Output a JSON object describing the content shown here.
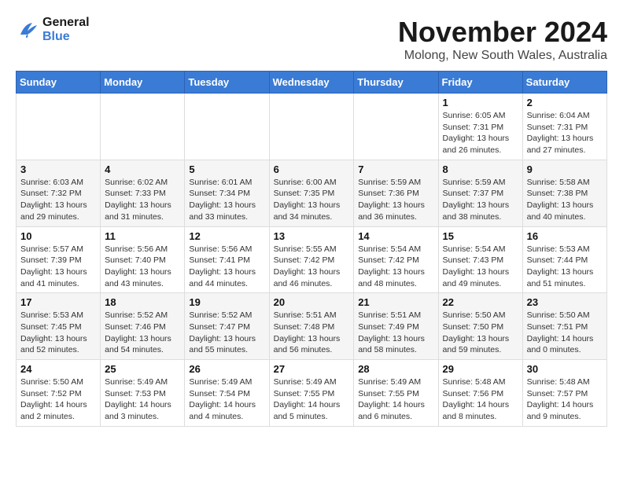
{
  "header": {
    "logo_line1": "General",
    "logo_line2": "Blue",
    "month": "November 2024",
    "location": "Molong, New South Wales, Australia"
  },
  "weekdays": [
    "Sunday",
    "Monday",
    "Tuesday",
    "Wednesday",
    "Thursday",
    "Friday",
    "Saturday"
  ],
  "weeks": [
    [
      {
        "day": "",
        "info": ""
      },
      {
        "day": "",
        "info": ""
      },
      {
        "day": "",
        "info": ""
      },
      {
        "day": "",
        "info": ""
      },
      {
        "day": "",
        "info": ""
      },
      {
        "day": "1",
        "info": "Sunrise: 6:05 AM\nSunset: 7:31 PM\nDaylight: 13 hours\nand 26 minutes."
      },
      {
        "day": "2",
        "info": "Sunrise: 6:04 AM\nSunset: 7:31 PM\nDaylight: 13 hours\nand 27 minutes."
      }
    ],
    [
      {
        "day": "3",
        "info": "Sunrise: 6:03 AM\nSunset: 7:32 PM\nDaylight: 13 hours\nand 29 minutes."
      },
      {
        "day": "4",
        "info": "Sunrise: 6:02 AM\nSunset: 7:33 PM\nDaylight: 13 hours\nand 31 minutes."
      },
      {
        "day": "5",
        "info": "Sunrise: 6:01 AM\nSunset: 7:34 PM\nDaylight: 13 hours\nand 33 minutes."
      },
      {
        "day": "6",
        "info": "Sunrise: 6:00 AM\nSunset: 7:35 PM\nDaylight: 13 hours\nand 34 minutes."
      },
      {
        "day": "7",
        "info": "Sunrise: 5:59 AM\nSunset: 7:36 PM\nDaylight: 13 hours\nand 36 minutes."
      },
      {
        "day": "8",
        "info": "Sunrise: 5:59 AM\nSunset: 7:37 PM\nDaylight: 13 hours\nand 38 minutes."
      },
      {
        "day": "9",
        "info": "Sunrise: 5:58 AM\nSunset: 7:38 PM\nDaylight: 13 hours\nand 40 minutes."
      }
    ],
    [
      {
        "day": "10",
        "info": "Sunrise: 5:57 AM\nSunset: 7:39 PM\nDaylight: 13 hours\nand 41 minutes."
      },
      {
        "day": "11",
        "info": "Sunrise: 5:56 AM\nSunset: 7:40 PM\nDaylight: 13 hours\nand 43 minutes."
      },
      {
        "day": "12",
        "info": "Sunrise: 5:56 AM\nSunset: 7:41 PM\nDaylight: 13 hours\nand 44 minutes."
      },
      {
        "day": "13",
        "info": "Sunrise: 5:55 AM\nSunset: 7:42 PM\nDaylight: 13 hours\nand 46 minutes."
      },
      {
        "day": "14",
        "info": "Sunrise: 5:54 AM\nSunset: 7:42 PM\nDaylight: 13 hours\nand 48 minutes."
      },
      {
        "day": "15",
        "info": "Sunrise: 5:54 AM\nSunset: 7:43 PM\nDaylight: 13 hours\nand 49 minutes."
      },
      {
        "day": "16",
        "info": "Sunrise: 5:53 AM\nSunset: 7:44 PM\nDaylight: 13 hours\nand 51 minutes."
      }
    ],
    [
      {
        "day": "17",
        "info": "Sunrise: 5:53 AM\nSunset: 7:45 PM\nDaylight: 13 hours\nand 52 minutes."
      },
      {
        "day": "18",
        "info": "Sunrise: 5:52 AM\nSunset: 7:46 PM\nDaylight: 13 hours\nand 54 minutes."
      },
      {
        "day": "19",
        "info": "Sunrise: 5:52 AM\nSunset: 7:47 PM\nDaylight: 13 hours\nand 55 minutes."
      },
      {
        "day": "20",
        "info": "Sunrise: 5:51 AM\nSunset: 7:48 PM\nDaylight: 13 hours\nand 56 minutes."
      },
      {
        "day": "21",
        "info": "Sunrise: 5:51 AM\nSunset: 7:49 PM\nDaylight: 13 hours\nand 58 minutes."
      },
      {
        "day": "22",
        "info": "Sunrise: 5:50 AM\nSunset: 7:50 PM\nDaylight: 13 hours\nand 59 minutes."
      },
      {
        "day": "23",
        "info": "Sunrise: 5:50 AM\nSunset: 7:51 PM\nDaylight: 14 hours\nand 0 minutes."
      }
    ],
    [
      {
        "day": "24",
        "info": "Sunrise: 5:50 AM\nSunset: 7:52 PM\nDaylight: 14 hours\nand 2 minutes."
      },
      {
        "day": "25",
        "info": "Sunrise: 5:49 AM\nSunset: 7:53 PM\nDaylight: 14 hours\nand 3 minutes."
      },
      {
        "day": "26",
        "info": "Sunrise: 5:49 AM\nSunset: 7:54 PM\nDaylight: 14 hours\nand 4 minutes."
      },
      {
        "day": "27",
        "info": "Sunrise: 5:49 AM\nSunset: 7:55 PM\nDaylight: 14 hours\nand 5 minutes."
      },
      {
        "day": "28",
        "info": "Sunrise: 5:49 AM\nSunset: 7:55 PM\nDaylight: 14 hours\nand 6 minutes."
      },
      {
        "day": "29",
        "info": "Sunrise: 5:48 AM\nSunset: 7:56 PM\nDaylight: 14 hours\nand 8 minutes."
      },
      {
        "day": "30",
        "info": "Sunrise: 5:48 AM\nSunset: 7:57 PM\nDaylight: 14 hours\nand 9 minutes."
      }
    ]
  ]
}
